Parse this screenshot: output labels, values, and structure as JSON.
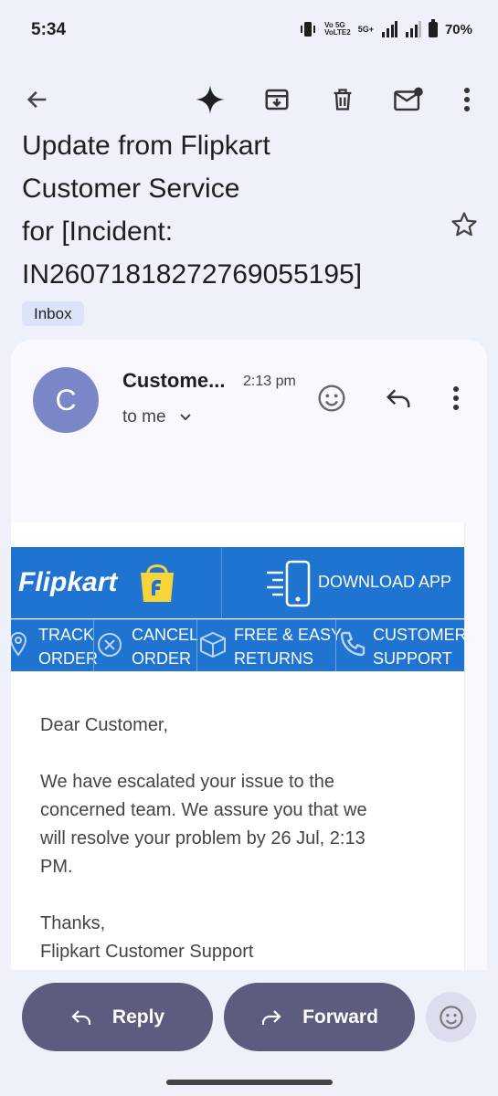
{
  "status": {
    "time": "5:34",
    "network1": "Vo 5G\nVoLTE2",
    "network2": "5G+",
    "battery": "70%"
  },
  "toolbar": {
    "back_icon": "arrow-left-icon",
    "gemini_icon": "sparkle-icon",
    "archive_icon": "archive-icon",
    "delete_icon": "trash-icon",
    "unread_icon": "mail-unread-icon",
    "more_icon": "more-vert-icon"
  },
  "email": {
    "subject_lines": [
      "Update from Flipkart",
      "Customer Service",
      "for [Incident:",
      "IN260718182727690551​95]"
    ],
    "label": "Inbox",
    "sender_initial": "C",
    "sender": "Custome...",
    "time": "2:13 pm",
    "recipient": "to me"
  },
  "flipkart": {
    "logo": "Flipkart",
    "download": "DOWNLOAD APP",
    "nav": [
      {
        "line1": "TRACK",
        "line2": "ORDER"
      },
      {
        "line1": "CANCEL",
        "line2": "ORDER"
      },
      {
        "line1": "FREE & EASY",
        "line2": "RETURNS"
      },
      {
        "line1": "CUSTOMER",
        "line2": "SUPPORT"
      }
    ]
  },
  "message": {
    "greeting": "Dear Customer,",
    "line1": "We have escalated your issue to the",
    "line2": "concerned team. We assure you that we",
    "line3": "will resolve your problem by 26 Jul, 2:13",
    "line4": "PM.",
    "thanks": "Thanks,",
    "signature": "Flipkart Customer Support"
  },
  "actions": {
    "reply": "Reply",
    "forward": "Forward"
  },
  "colors": {
    "flipkart_blue": "#1f74d1",
    "flipkart_yellow": "#f8d33a",
    "button": "#5b5c7e",
    "avatar": "#7b86c8"
  }
}
